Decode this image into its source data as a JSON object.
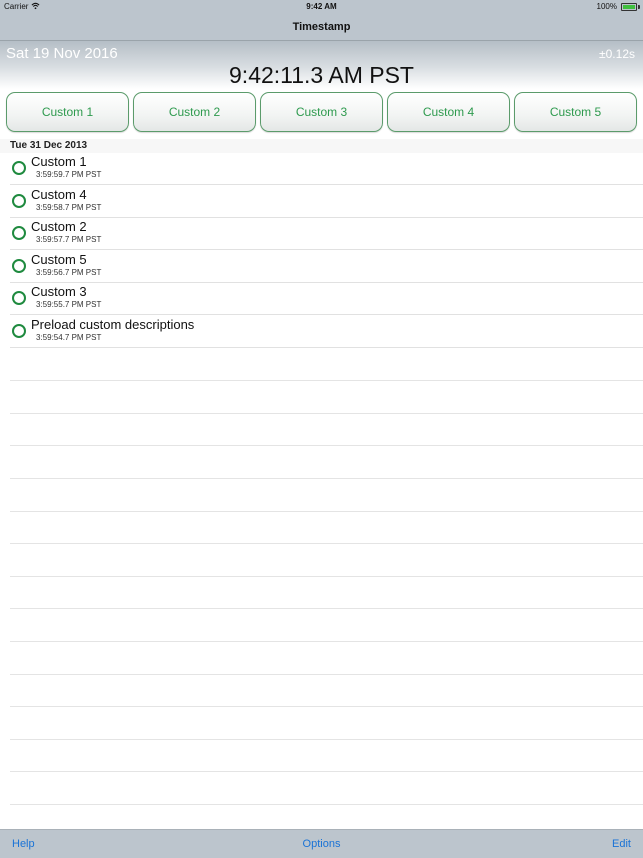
{
  "status_bar": {
    "carrier": "Carrier",
    "time": "9:42 AM",
    "battery": "100%",
    "wifi_icon": "wifi-icon",
    "battery_icon": "battery-icon"
  },
  "nav": {
    "title": "Timestamp"
  },
  "header": {
    "date": "Sat 19 Nov 2016",
    "accuracy": "±0.12s",
    "clock": "9:42:11.3 AM PST"
  },
  "custom_buttons": [
    {
      "label": "Custom 1"
    },
    {
      "label": "Custom 2"
    },
    {
      "label": "Custom 3"
    },
    {
      "label": "Custom 4"
    },
    {
      "label": "Custom 5"
    }
  ],
  "section": {
    "title": "Tue 31 Dec 2013"
  },
  "entries": [
    {
      "title": "Custom 1",
      "time": "3:59:59.7 PM PST"
    },
    {
      "title": "Custom 4",
      "time": "3:59:58.7 PM PST"
    },
    {
      "title": "Custom 2",
      "time": "3:59:57.7 PM PST"
    },
    {
      "title": "Custom 5",
      "time": "3:59:56.7 PM PST"
    },
    {
      "title": "Custom 3",
      "time": "3:59:55.7 PM PST"
    },
    {
      "title": "Preload custom descriptions",
      "time": "3:59:54.7 PM PST"
    }
  ],
  "toolbar": {
    "help": "Help",
    "options": "Options",
    "edit": "Edit"
  },
  "colors": {
    "accent": "#2e9a4e",
    "ring": "#1f8a3f",
    "link": "#1a73d6",
    "bar": "#bcc5cd"
  }
}
